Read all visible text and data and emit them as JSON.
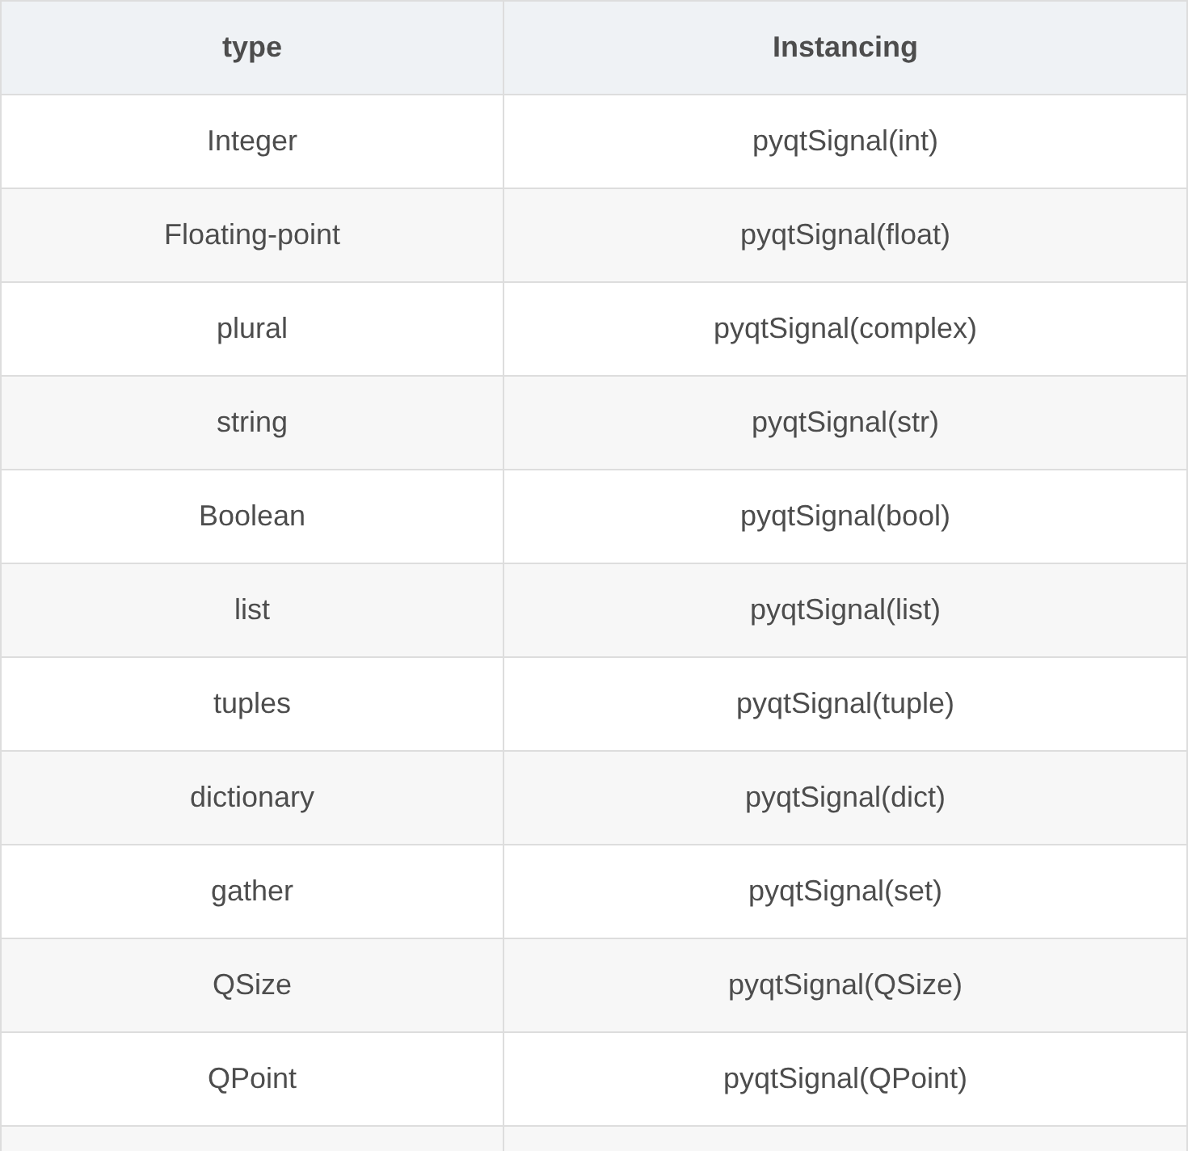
{
  "table": {
    "columns": [
      "type",
      "Instancing"
    ],
    "rows": [
      [
        "Integer",
        "pyqtSignal(int)"
      ],
      [
        "Floating-point",
        "pyqtSignal(float)"
      ],
      [
        "plural",
        "pyqtSignal(complex)"
      ],
      [
        "string",
        "pyqtSignal(str)"
      ],
      [
        "Boolean",
        "pyqtSignal(bool)"
      ],
      [
        "list",
        "pyqtSignal(list)"
      ],
      [
        "tuples",
        "pyqtSignal(tuple)"
      ],
      [
        "dictionary",
        "pyqtSignal(dict)"
      ],
      [
        "gather",
        "pyqtSignal(set)"
      ],
      [
        "QSize",
        "pyqtSignal(QSize)"
      ],
      [
        "QPoint",
        "pyqtSignal(QPoint)"
      ]
    ]
  }
}
